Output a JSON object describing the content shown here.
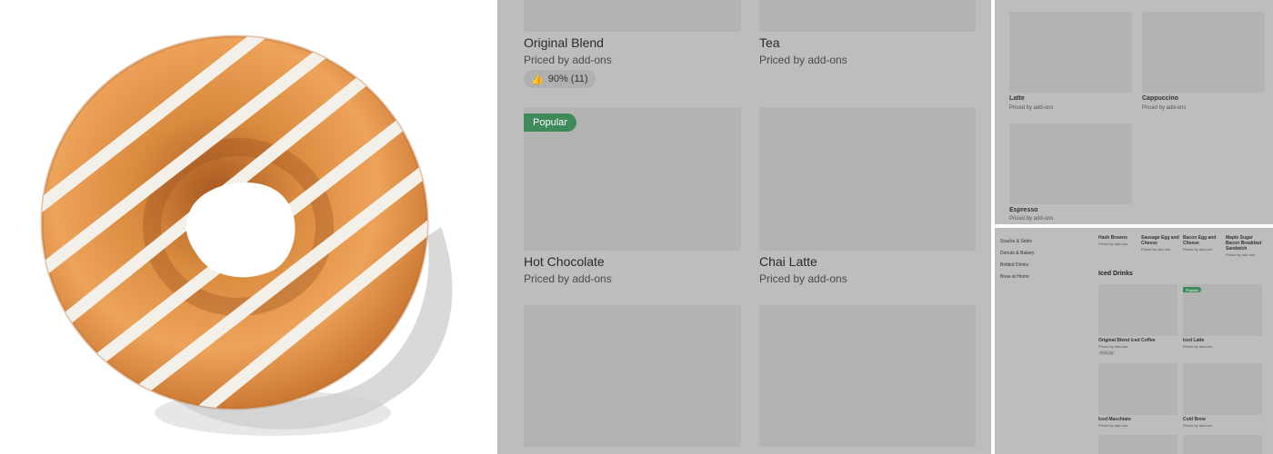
{
  "middle": {
    "items": [
      {
        "name": "Original Blend",
        "sub": "Priced by add-ons"
      },
      {
        "name": "Tea",
        "sub": "Priced by add-ons"
      },
      {
        "name": "Hot Chocolate",
        "sub": "Priced by add-ons"
      },
      {
        "name": "Chai Latte",
        "sub": "Priced by add-ons"
      }
    ],
    "rating": "90% (11)",
    "badge": "Popular"
  },
  "top_right": {
    "items": [
      {
        "name": "Latte",
        "sub": "Priced by add-ons"
      },
      {
        "name": "Cappuccino",
        "sub": "Priced by add-ons"
      },
      {
        "name": "Espresso",
        "sub": "Priced by add-ons"
      }
    ]
  },
  "bottom_right": {
    "sidebar": [
      "Snacks & Sides",
      "Donuts & Bakery",
      "Bottled Drinks",
      "Brew at Home"
    ],
    "top_items": [
      {
        "name": "Hash Browns",
        "sub": "Priced by add-ons"
      },
      {
        "name": "Sausage Egg and Cheese",
        "sub": "Priced by add-ons"
      },
      {
        "name": "Bacon Egg and Cheese",
        "sub": "Priced by add-ons"
      },
      {
        "name": "Maple Sugar Bacon Breakfast Sandwich",
        "sub": "Priced by add-ons"
      }
    ],
    "section_title": "Iced Drinks",
    "badge": "Popular",
    "items": [
      {
        "name": "Original Blend Iced Coffee",
        "sub": "Priced by add-ons"
      },
      {
        "name": "Iced Latte",
        "sub": "Priced by add-ons"
      },
      {
        "name": "Iced Macchiato",
        "sub": "Priced by add-ons"
      },
      {
        "name": "Cold Brew",
        "sub": "Priced by add-ons"
      }
    ],
    "rating": "97% (3)"
  },
  "colors": {
    "panel_bg": "#bdbdbd",
    "placeholder": "#b3b3b3",
    "badge": "#3e8a5a",
    "glaze": "#f3f0ea",
    "donut": "#d98a3e"
  }
}
